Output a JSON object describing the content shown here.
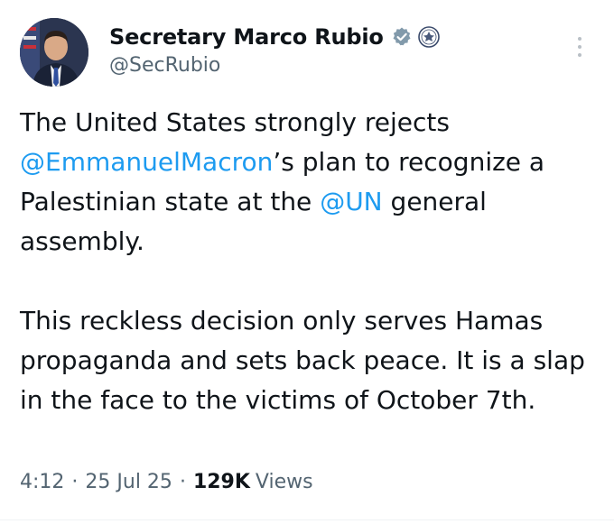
{
  "author": {
    "display_name": "Secretary Marco Rubio",
    "handle": "@SecRubio",
    "verified_badge_color": "#829aab",
    "badges": [
      "verified-badge-icon",
      "state-department-seal-icon"
    ]
  },
  "tweet": {
    "paragraph1": {
      "text_before_mention1": "The United States strongly rejects ",
      "mention1": "@EmmanuelMacron",
      "text_between": "’s plan to recognize a Palestinian state at the ",
      "mention2": "@UN",
      "text_after": " general assembly."
    },
    "paragraph2": "This reckless decision only serves Hamas propaganda and sets back peace. It is a slap in the face to the victims of October 7th."
  },
  "meta": {
    "time": "4:12",
    "separator": "·",
    "date": "25 Jul 25",
    "views_count": "129K",
    "views_label": "Views"
  },
  "colors": {
    "text": "#0f1419",
    "secondary": "#536471",
    "link": "#1d9bf0"
  }
}
